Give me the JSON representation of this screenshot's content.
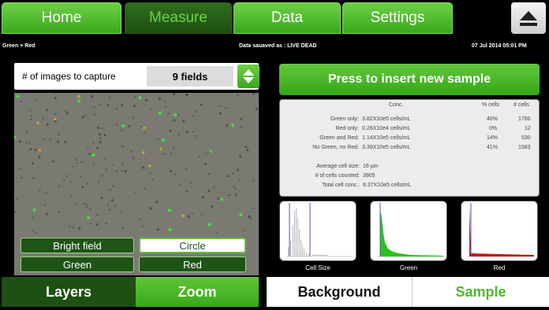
{
  "top_tabs": [
    "Home",
    "Measure",
    "Data",
    "Settings"
  ],
  "active_tab": "Measure",
  "status": {
    "left": "Green + Red",
    "center": "Data sauaved as : LIVE DEAD",
    "right": "07 Jul 2014  05:01 PM"
  },
  "capture": {
    "label": "# of images to capture",
    "value": "9 fields"
  },
  "layers": {
    "bright_field": "Bright field",
    "circle": "Circle",
    "green": "Green",
    "red": "Red"
  },
  "left_bottom_tabs": {
    "layers": "Layers",
    "zoom": "Zoom"
  },
  "insert_button": "Press to insert new sample",
  "results": {
    "headers": {
      "conc": "Conc.",
      "pct": "% cells",
      "count": "# cells"
    },
    "rows": [
      {
        "label": "Green only:",
        "conc": "3.82X10e5 cells/mL",
        "pct": "46%",
        "count": "1780"
      },
      {
        "label": "Red only:",
        "conc": "0.26X10e4 cells/mL",
        "pct": "0%",
        "count": "12"
      },
      {
        "label": "Green and Red:",
        "conc": "1.14X10e5 cells/mL",
        "pct": "14%",
        "count": "530"
      },
      {
        "label": "No Green, no Red:",
        "conc": "3.39X10e5 cells/mL",
        "pct": "41%",
        "count": "1583"
      }
    ],
    "summary": [
      {
        "label": "Average cell size:",
        "value": "16 µm"
      },
      {
        "label": "# of cells counted:",
        "value": "3905"
      },
      {
        "label": "Total cell conc.:",
        "value": "8.37X10e5 cells/mL"
      }
    ]
  },
  "histograms": {
    "cell_size": "Cell Size",
    "green": "Green",
    "red": "Red"
  },
  "right_bottom_tabs": {
    "background": "Background",
    "sample": "Sample"
  },
  "colors": {
    "accent_green": "#3aa81c",
    "dark_green": "#1f5417",
    "tab_text_active": "#6fd046"
  }
}
